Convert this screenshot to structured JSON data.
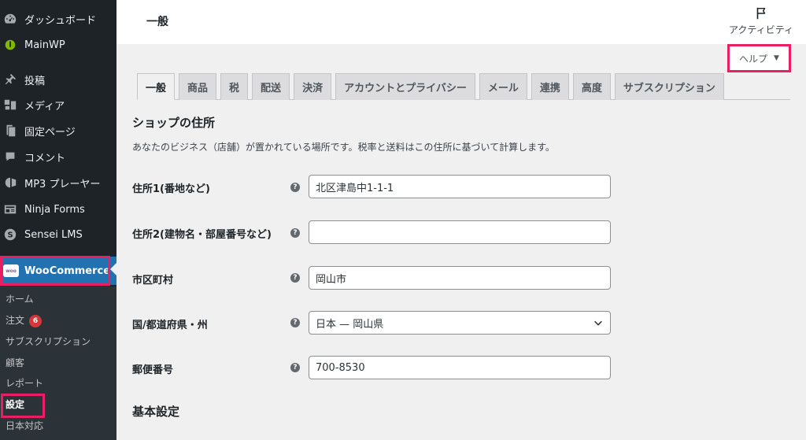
{
  "sidebar": {
    "items": [
      {
        "label": "ダッシュボード",
        "icon": "dashboard-icon"
      },
      {
        "label": "MainWP",
        "icon": "mainwp-icon"
      },
      {
        "label": "投稿",
        "icon": "pin-icon"
      },
      {
        "label": "メディア",
        "icon": "media-icon"
      },
      {
        "label": "固定ページ",
        "icon": "page-icon"
      },
      {
        "label": "コメント",
        "icon": "comment-icon"
      },
      {
        "label": "MP3 プレーヤー",
        "icon": "player-icon"
      },
      {
        "label": "Ninja Forms",
        "icon": "form-icon"
      },
      {
        "label": "Sensei LMS",
        "icon": "sensei-icon"
      }
    ],
    "woocommerce": {
      "label": "WooCommerce",
      "logo_text": "woo"
    },
    "submenu": [
      {
        "label": "ホーム"
      },
      {
        "label": "注文",
        "badge": "6"
      },
      {
        "label": "サブスクリプション"
      },
      {
        "label": "顧客"
      },
      {
        "label": "レポート"
      },
      {
        "label": "設定"
      },
      {
        "label": "日本対応"
      }
    ],
    "colors": {
      "bg": "#1d2327",
      "active": "#2271b1",
      "badge": "#d63638"
    }
  },
  "header": {
    "title": "一般",
    "activity_label": "アクティビティ",
    "help_label": "ヘルプ",
    "help_arrow": "▼"
  },
  "tabs": [
    {
      "label": "一般",
      "active": true
    },
    {
      "label": "商品"
    },
    {
      "label": "税"
    },
    {
      "label": "配送"
    },
    {
      "label": "決済"
    },
    {
      "label": "アカウントとプライバシー"
    },
    {
      "label": "メール"
    },
    {
      "label": "連携"
    },
    {
      "label": "高度"
    },
    {
      "label": "サブスクリプション"
    }
  ],
  "store_address": {
    "heading": "ショップの住所",
    "description": "あなたのビジネス（店舗）が置かれている場所です。税率と送料はこの住所に基づいて計算します。",
    "help_glyph": "?",
    "fields": [
      {
        "label": "住所1(番地など)",
        "value": "北区津島中1-1-1"
      },
      {
        "label": "住所2(建物名・部屋番号など)",
        "value": ""
      },
      {
        "label": "市区町村",
        "value": "岡山市"
      },
      {
        "label": "国/都道府県・州",
        "value": "日本 — 岡山県"
      },
      {
        "label": "郵便番号",
        "value": "700-8530"
      }
    ]
  },
  "general_options": {
    "heading": "基本設定"
  },
  "highlight_color": "#e91e63"
}
